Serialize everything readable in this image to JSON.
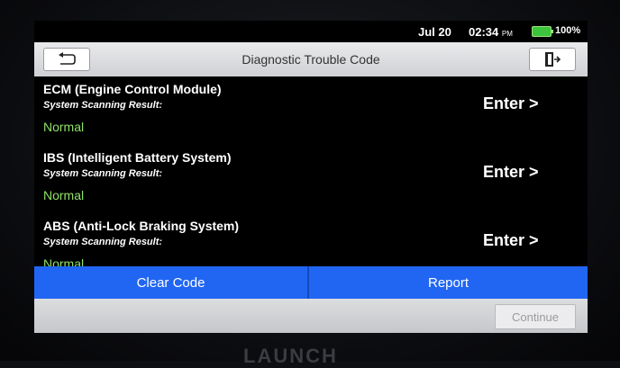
{
  "status": {
    "date": "Jul 20",
    "time": "02:34",
    "ampm": "PM",
    "battery": "100%",
    "battery_color": "#3cc43c"
  },
  "header": {
    "title": "Diagnostic Trouble Code",
    "back_icon": "back-arrow-icon",
    "exit_icon": "exit-door-icon"
  },
  "items": [
    {
      "title": "ECM (Engine Control Module)",
      "subtitle": "System Scanning Result:",
      "status": "Normal",
      "enter": "Enter >"
    },
    {
      "title": "IBS (Intelligent Battery System)",
      "subtitle": "System Scanning Result:",
      "status": "Normal",
      "enter": "Enter >"
    },
    {
      "title": "ABS (Anti-Lock Braking System)",
      "subtitle": "System Scanning Result:",
      "status": "Normal",
      "enter": "Enter >"
    }
  ],
  "actions": {
    "clear_code": "Clear Code",
    "report": "Report",
    "accent": "#2166f3"
  },
  "footer": {
    "continue": "Continue"
  },
  "status_color": "#8fe26a",
  "bezel_brand": "LAUNCH"
}
